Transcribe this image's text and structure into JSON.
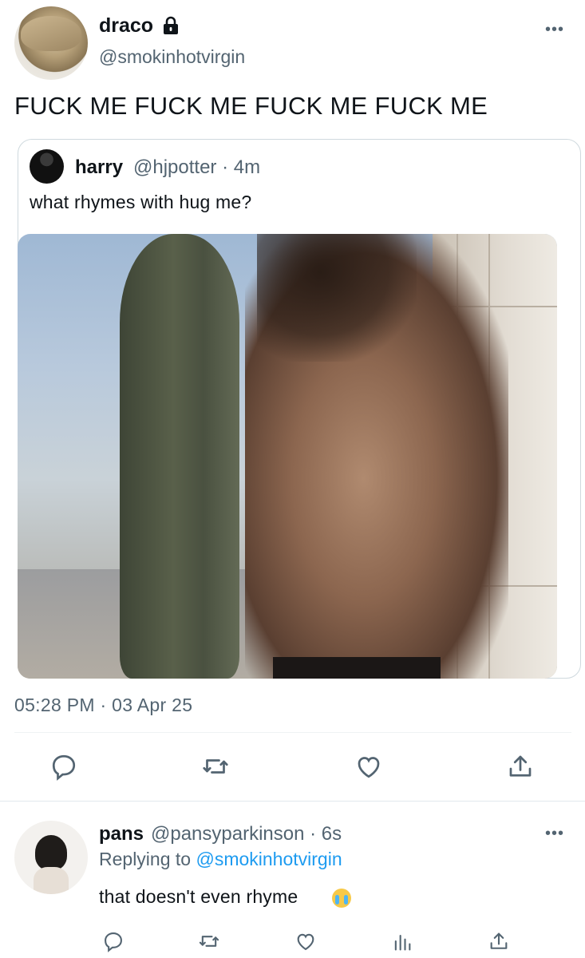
{
  "main_tweet": {
    "display_name": "draco",
    "handle": "@smokinhotvirgin",
    "text": "FUCK ME FUCK ME FUCK ME FUCK ME",
    "timestamp": "05:28 PM · 03 Apr 25",
    "more_glyph": "•••"
  },
  "quoted_tweet": {
    "display_name": "harry",
    "meta": "@hjpotter · 4m",
    "text": "what rhymes with hug me?"
  },
  "reply": {
    "display_name": "pans",
    "meta": "@pansyparkinson · 6s",
    "replying_prefix": "Replying to",
    "replying_mention": "@smokinhotvirgin",
    "text": "that doesn't even rhyme",
    "more_glyph": "•••"
  },
  "colors": {
    "text_primary": "#0f1419",
    "text_secondary": "#536471",
    "accent": "#1d9bf0",
    "border": "#cfd9de"
  },
  "icons": {
    "main_actions": [
      "reply-icon",
      "retweet-icon",
      "like-icon",
      "share-icon"
    ],
    "reply_actions": [
      "reply-icon",
      "retweet-icon",
      "like-icon",
      "analytics-icon",
      "share-icon"
    ],
    "protected": "lock-icon",
    "more": "more-icon"
  }
}
